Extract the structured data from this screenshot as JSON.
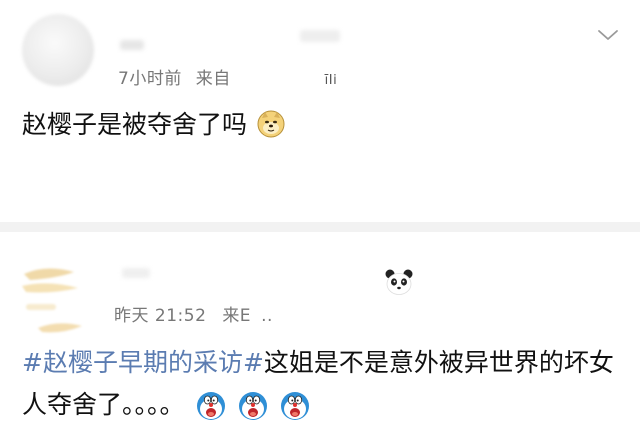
{
  "post1": {
    "time": "7小时前",
    "source_prefix": "来自",
    "source_tail": "īIi",
    "text": "赵樱子是被夺舍了吗",
    "emoji": "doge-icon"
  },
  "post2": {
    "time": "昨天 21:52",
    "source_prefix": "来E",
    "source_tail": "..",
    "topic": "#赵樱子早期的采访#",
    "text": "这姐是不是意外被异世界的坏女人夺舍了。。。。",
    "emojis": [
      "doraemon-shocked-icon",
      "doraemon-shocked-icon",
      "doraemon-shocked-icon"
    ],
    "reaction": "panda-icon"
  },
  "colors": {
    "topic": "#5b7cb1",
    "meta": "#777777",
    "text": "#111111",
    "separator": "#f2f2f2"
  }
}
